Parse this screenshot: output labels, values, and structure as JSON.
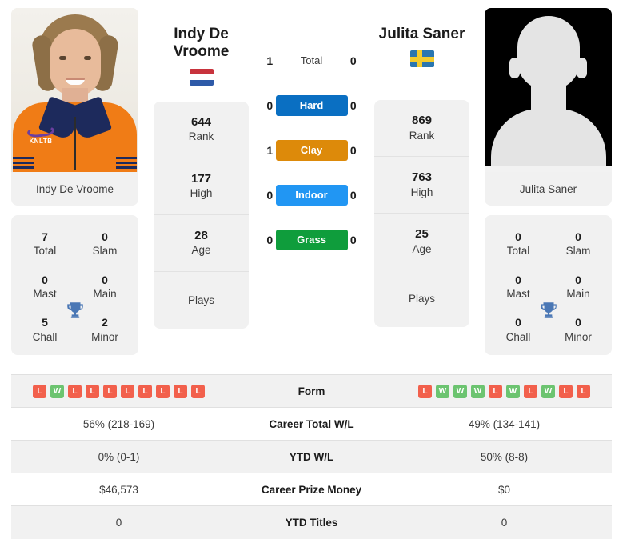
{
  "players": {
    "left": {
      "name": "Indy De Vroome",
      "name_line1": "Indy De",
      "name_line2": "Vroome",
      "country_code": "NL",
      "photo_alt": "Indy De Vroome headshot",
      "stats": [
        {
          "value": "644",
          "label": "Rank"
        },
        {
          "value": "177",
          "label": "High"
        },
        {
          "value": "28",
          "label": "Age"
        },
        {
          "value": "",
          "label": "Plays"
        }
      ],
      "titles": [
        {
          "value": "7",
          "label": "Total"
        },
        {
          "value": "0",
          "label": "Slam"
        },
        {
          "value": "0",
          "label": "Mast"
        },
        {
          "value": "0",
          "label": "Main"
        },
        {
          "value": "5",
          "label": "Chall"
        },
        {
          "value": "2",
          "label": "Minor"
        }
      ],
      "form": [
        "L",
        "W",
        "L",
        "L",
        "L",
        "L",
        "L",
        "L",
        "L",
        "L"
      ],
      "career_total_wl": "56% (218-169)",
      "ytd_wl": "0% (0-1)",
      "career_prize_money": "$46,573",
      "ytd_titles": "0"
    },
    "right": {
      "name": "Julita Saner",
      "name_line1": "Julita Saner",
      "name_line2": "",
      "country_code": "SE",
      "photo_alt": "Julita Saner placeholder silhouette",
      "stats": [
        {
          "value": "869",
          "label": "Rank"
        },
        {
          "value": "763",
          "label": "High"
        },
        {
          "value": "25",
          "label": "Age"
        },
        {
          "value": "",
          "label": "Plays"
        }
      ],
      "titles": [
        {
          "value": "0",
          "label": "Total"
        },
        {
          "value": "0",
          "label": "Slam"
        },
        {
          "value": "0",
          "label": "Mast"
        },
        {
          "value": "0",
          "label": "Main"
        },
        {
          "value": "0",
          "label": "Chall"
        },
        {
          "value": "0",
          "label": "Minor"
        }
      ],
      "form": [
        "L",
        "W",
        "W",
        "W",
        "L",
        "W",
        "L",
        "W",
        "L",
        "L"
      ],
      "career_total_wl": "49% (134-141)",
      "ytd_wl": "50% (8-8)",
      "career_prize_money": "$0",
      "ytd_titles": "0"
    }
  },
  "head_to_head": [
    {
      "label": "Total",
      "left": "1",
      "right": "0",
      "color": ""
    },
    {
      "label": "Hard",
      "left": "0",
      "right": "0",
      "color": "#0a6fc2"
    },
    {
      "label": "Clay",
      "left": "1",
      "right": "0",
      "color": "#dd8a0a"
    },
    {
      "label": "Indoor",
      "left": "0",
      "right": "0",
      "color": "#2196f3"
    },
    {
      "label": "Grass",
      "left": "0",
      "right": "0",
      "color": "#0f9d3c"
    }
  ],
  "table": {
    "rows": [
      {
        "label": "Form",
        "type": "form"
      },
      {
        "label": "Career Total W/L",
        "type": "text",
        "key": "career_total_wl"
      },
      {
        "label": "YTD W/L",
        "type": "text",
        "key": "ytd_wl"
      },
      {
        "label": "Career Prize Money",
        "type": "text",
        "key": "career_prize_money"
      },
      {
        "label": "YTD Titles",
        "type": "text",
        "key": "ytd_titles"
      }
    ]
  },
  "colors": {
    "win": "#6cc470",
    "loss": "#f2604c",
    "card_bg": "#f1f1f1",
    "trophy": "#4a77b5"
  },
  "icons": {
    "trophy": "trophy-icon",
    "flag_left": "flag-netherlands-icon",
    "flag_right": "flag-sweden-icon"
  }
}
